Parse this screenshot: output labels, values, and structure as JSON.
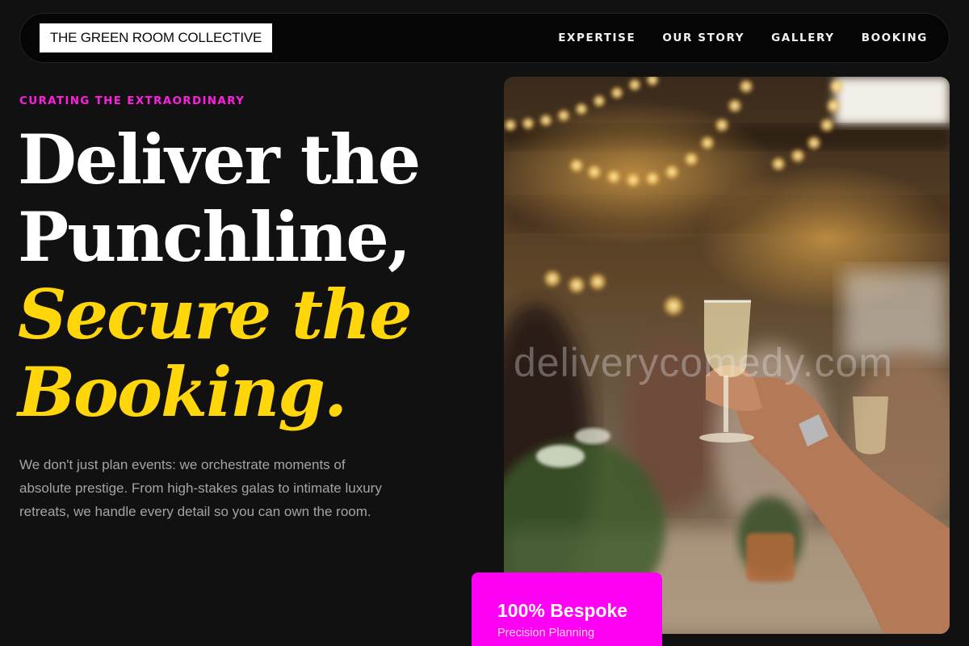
{
  "brand": {
    "name": "THE GREEN ROOM COLLECTIVE"
  },
  "nav": {
    "items": [
      {
        "label": "EXPERTISE"
      },
      {
        "label": "OUR STORY"
      },
      {
        "label": "GALLERY"
      },
      {
        "label": "BOOKING"
      }
    ]
  },
  "hero": {
    "eyebrow": "CURATING THE EXTRAORDINARY",
    "headline_lines": [
      "Deliver the",
      "Punchline,"
    ],
    "headline_accent_lines": [
      "Secure the",
      "Booking."
    ],
    "body": "We don't just plan events: we orchestrate moments of absolute prestige. From high-stakes galas to intimate luxury retreats, we handle every detail so you can own the room."
  },
  "image": {
    "subject": "celebration-toast-photo",
    "watermark": "deliverycomedy.com"
  },
  "badge": {
    "title": "100% Bespoke",
    "subtitle": "Precision Planning"
  },
  "colors": {
    "background": "#111112",
    "accent_yellow": "#ffd60a",
    "accent_magenta": "#ff00f5",
    "eyebrow_pink": "#ff1ee0"
  }
}
